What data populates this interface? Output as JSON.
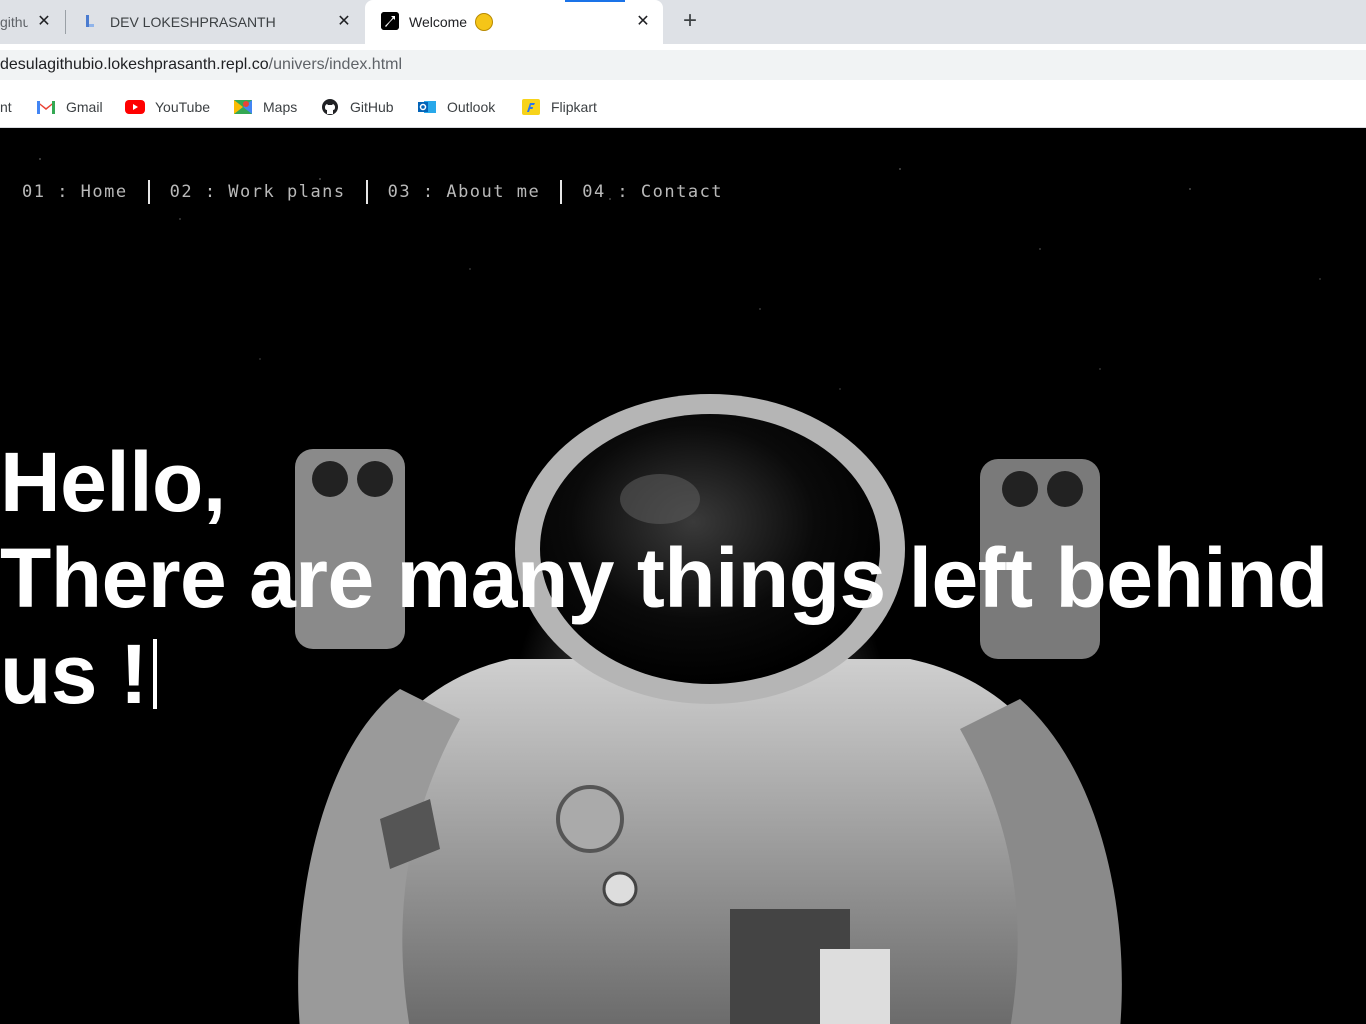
{
  "browser": {
    "tabs": [
      {
        "label": "githu",
        "active": false
      },
      {
        "label": "DEV LOKESHPRASANTH",
        "active": false
      },
      {
        "label": "Welcome",
        "active": true
      }
    ],
    "url": {
      "host": "desulagithubio.lokeshprasanth.repl.co",
      "path": "/univers/index.html"
    },
    "bookmarks": [
      {
        "label": "nt",
        "icon": "unknown-icon"
      },
      {
        "label": "Gmail",
        "icon": "gmail-icon"
      },
      {
        "label": "YouTube",
        "icon": "youtube-icon"
      },
      {
        "label": "Maps",
        "icon": "maps-icon"
      },
      {
        "label": "GitHub",
        "icon": "github-icon"
      },
      {
        "label": "Outlook",
        "icon": "outlook-icon"
      },
      {
        "label": "Flipkart",
        "icon": "flipkart-icon"
      }
    ]
  },
  "page": {
    "nav": [
      {
        "label": "01 : Home"
      },
      {
        "label": "02 : Work plans"
      },
      {
        "label": "03 : About me"
      },
      {
        "label": "04 : Contact"
      }
    ],
    "headline": {
      "line1": "Hello,",
      "line2": "There are many things left behind",
      "line3": "us !"
    }
  },
  "colors": {
    "tabstrip": "#dee1e6",
    "nav_text": "#b9b9b9",
    "headline": "#ffffff",
    "background": "#000000"
  }
}
